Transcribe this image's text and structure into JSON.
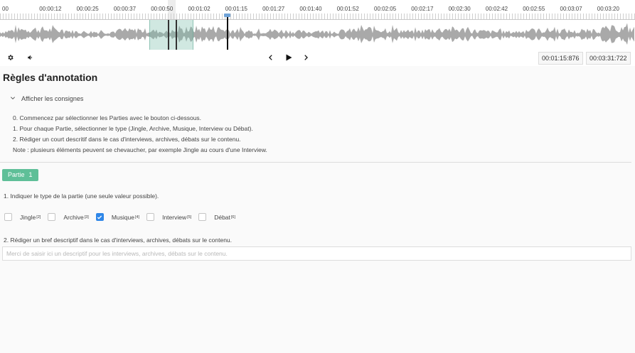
{
  "player": {
    "timeline_labels": [
      "00",
      "00:00:12",
      "00:00:25",
      "00:00:37",
      "00:00:50",
      "00:01:02",
      "00:01:15",
      "00:01:27",
      "00:01:40",
      "00:01:52",
      "00:02:05",
      "00:02:17",
      "00:02:30",
      "00:02:42",
      "00:02:55",
      "00:03:07",
      "00:03:20"
    ],
    "current_time": "00:01:15:876",
    "total_time": "00:03:31:722",
    "icons": {
      "settings": "gear-icon",
      "volume": "speaker-icon",
      "previous": "chevron-left-icon",
      "play": "play-icon",
      "next": "chevron-right-icon"
    },
    "colors": {
      "waveform": "#a9a9a9",
      "region": "#78beaa",
      "playhead_handle": "#6fa3d8"
    }
  },
  "rules": {
    "title": "Règles d'annotation",
    "toggle_label": "Afficher les consignes",
    "lines": [
      "0. Commencez par sélectionner les Parties avec le bouton ci-dessous.",
      "1. Pour chaque Partie, sélectionner le type (Jingle, Archive, Musique, Interview ou Débat).",
      "2. Rédiger un court descritif dans le cas d'interviews, archives, débats sur le contenu.",
      "Note : plusieurs éléments peuvent se chevaucher, par exemple Jingle au cours d'une Interview."
    ]
  },
  "part": {
    "label": "Partie",
    "number": "1",
    "color": "#5fbf98"
  },
  "question1": "1. Indiquer le type de la partie (une seule valeur possible).",
  "types": [
    {
      "label": "Jingle",
      "key": "[2]",
      "checked": false
    },
    {
      "label": "Archive",
      "key": "[3]",
      "checked": false
    },
    {
      "label": "Musique",
      "key": "[4]",
      "checked": true
    },
    {
      "label": "Interview",
      "key": "[5]",
      "checked": false
    },
    {
      "label": "Débat",
      "key": "[6]",
      "checked": false
    }
  ],
  "question2": "2. Rédiger un bref descriptif dans le cas d'interviews, archives, débats sur le contenu.",
  "description": {
    "value": "",
    "placeholder": "Merci de saisir ici un descriptif pour les interviews, archives, débats sur le contenu."
  },
  "accent_color": "#2f87e8"
}
